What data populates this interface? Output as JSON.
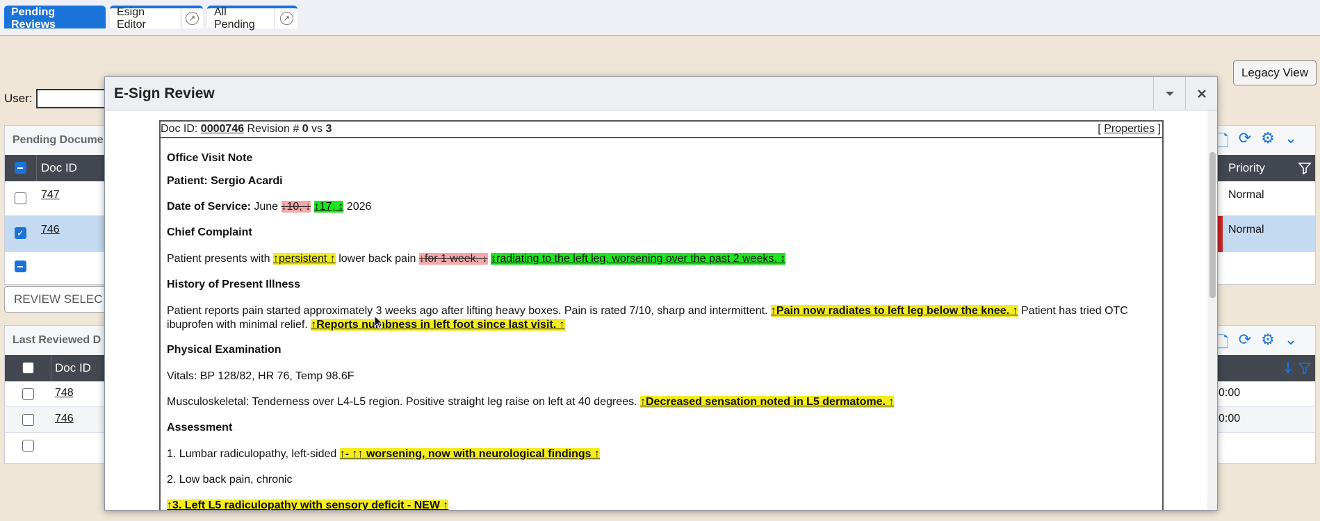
{
  "tabs": [
    {
      "label": "Pending Reviews",
      "active": true
    },
    {
      "label": "Esign Editor",
      "active": false
    },
    {
      "label": "All Pending",
      "active": false
    }
  ],
  "legacy_view_label": "Legacy View",
  "user_label": "User:",
  "user_value": "",
  "pending_panel": {
    "title": "Pending Docume",
    "col_doc_id": "Doc ID",
    "col_priority": "Priority",
    "rows": [
      {
        "doc_id": "747",
        "priority": "Normal",
        "checked": false
      },
      {
        "doc_id": "746",
        "priority": "Normal",
        "checked": true
      }
    ]
  },
  "review_selected_label": "REVIEW SELEC",
  "last_reviewed_panel": {
    "title": "Last Reviewed D",
    "col_doc_id": "Doc ID",
    "rows": [
      {
        "doc_id": "748",
        "time": "0:00"
      },
      {
        "doc_id": "746",
        "time": "0:00"
      }
    ]
  },
  "modal": {
    "title": "E-Sign Review",
    "doc_header": {
      "prefix": "Doc ID: ",
      "doc_id": "0000746",
      "revision_text": " Revision # ",
      "rev_a": "0",
      "vs": " vs ",
      "rev_b": "3",
      "properties_open": "[ ",
      "properties": "Properties",
      "properties_close": " ]"
    },
    "note": {
      "title": "Office Visit Note",
      "patient": "Patient: Sergio Acardi",
      "dos_label": "Date of Service:",
      "dos_month": " June ",
      "dos_del": "↓10, ↓",
      "dos_ins": "↕17, ↕",
      "dos_year": " 2026",
      "cc_heading": "Chief Complaint",
      "cc_pre": "Patient presents with ",
      "cc_mod": "↑persistent ↑",
      "cc_mid": " lower back pain ",
      "cc_del": "↓for 1 week. ↓",
      "cc_ins": "↕radiating to the left leg, worsening over the past 2 weeks. ↕",
      "hpi_heading": "History of Present Illness",
      "hpi_text1": "Patient reports pain started approximately 3 weeks ago after lifting heavy boxes. Pain is rated 7/10, sharp and intermittent. ",
      "hpi_mod1": "↑Pain now radiates to left leg below the knee. ↑",
      "hpi_text2": " Patient has tried OTC ibuprofen with minimal relief. ",
      "hpi_mod2": "↑Reports numbness in left foot since last visit. ↑",
      "pe_heading": "Physical Examination",
      "vitals": "Vitals: BP 128/82, HR 76, Temp 98.6F",
      "msk_text": "Musculoskeletal: Tenderness over L4-L5 region. Positive straight leg raise on left at 40 degrees. ",
      "msk_mod": "↑Decreased sensation noted in L5 dermatome. ↑",
      "assess_heading": "Assessment",
      "a1_text": "1. Lumbar radiculopathy, left-sided ",
      "a1_mod1": "↑- ↑",
      "a1_mod2": "↑ worsening, now with neurological findings ↑",
      "a2_text": "2. Low back pain, chronic",
      "a3_mod": "↑3. Left L5 radiculopathy with sensory deficit - NEW ↑"
    }
  },
  "colors": {
    "accent": "#1a73d9",
    "deleted": "#f4a8a8",
    "inserted": "#1ee51e",
    "modified": "#f3ec1f",
    "priority_flag": "#c62828"
  }
}
